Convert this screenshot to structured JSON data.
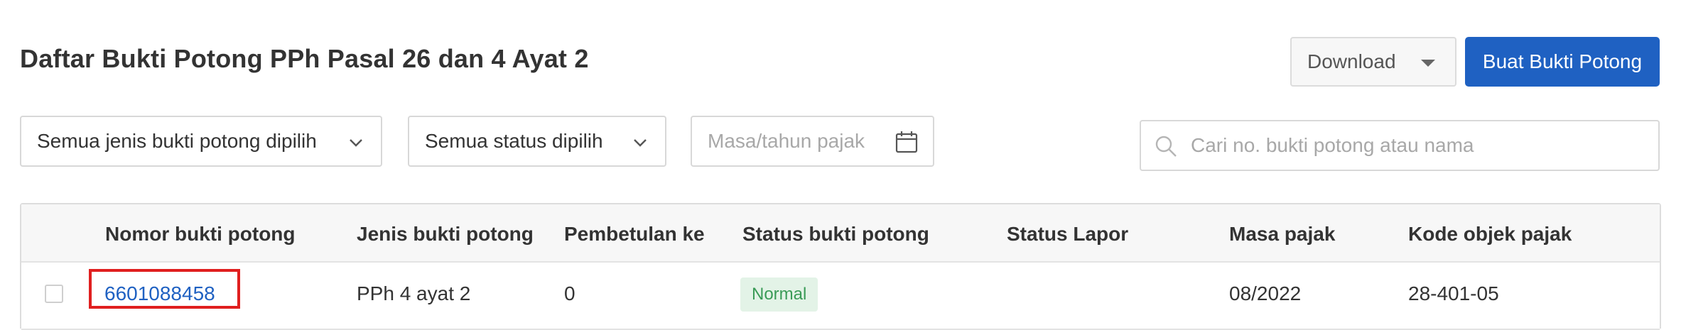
{
  "page": {
    "title": "Daftar Bukti Potong PPh Pasal 26 dan 4 Ayat 2"
  },
  "toolbar": {
    "download_label": "Download",
    "create_label": "Buat Bukti Potong"
  },
  "filters": {
    "type_select": "Semua jenis bukti potong dipilih",
    "status_select": "Semua status dipilih",
    "period_placeholder": "Masa/tahun pajak",
    "search_placeholder": "Cari no. bukti potong atau nama"
  },
  "table": {
    "columns": [
      "Nomor bukti potong",
      "Jenis bukti potong",
      "Pembetulan ke",
      "Status bukti potong",
      "Status Lapor",
      "Masa pajak",
      "Kode objek pajak"
    ],
    "rows": [
      {
        "nomor": "6601088458",
        "jenis": "PPh 4 ayat 2",
        "pembetulan": "0",
        "status": "Normal",
        "status_lapor": "",
        "masa": "08/2022",
        "kode": "28-401-05"
      }
    ]
  },
  "colors": {
    "primary": "#1f61c2",
    "highlight_border": "#e01f1f",
    "status_badge_bg": "#e3f3e7",
    "status_badge_text": "#3a9b57"
  }
}
